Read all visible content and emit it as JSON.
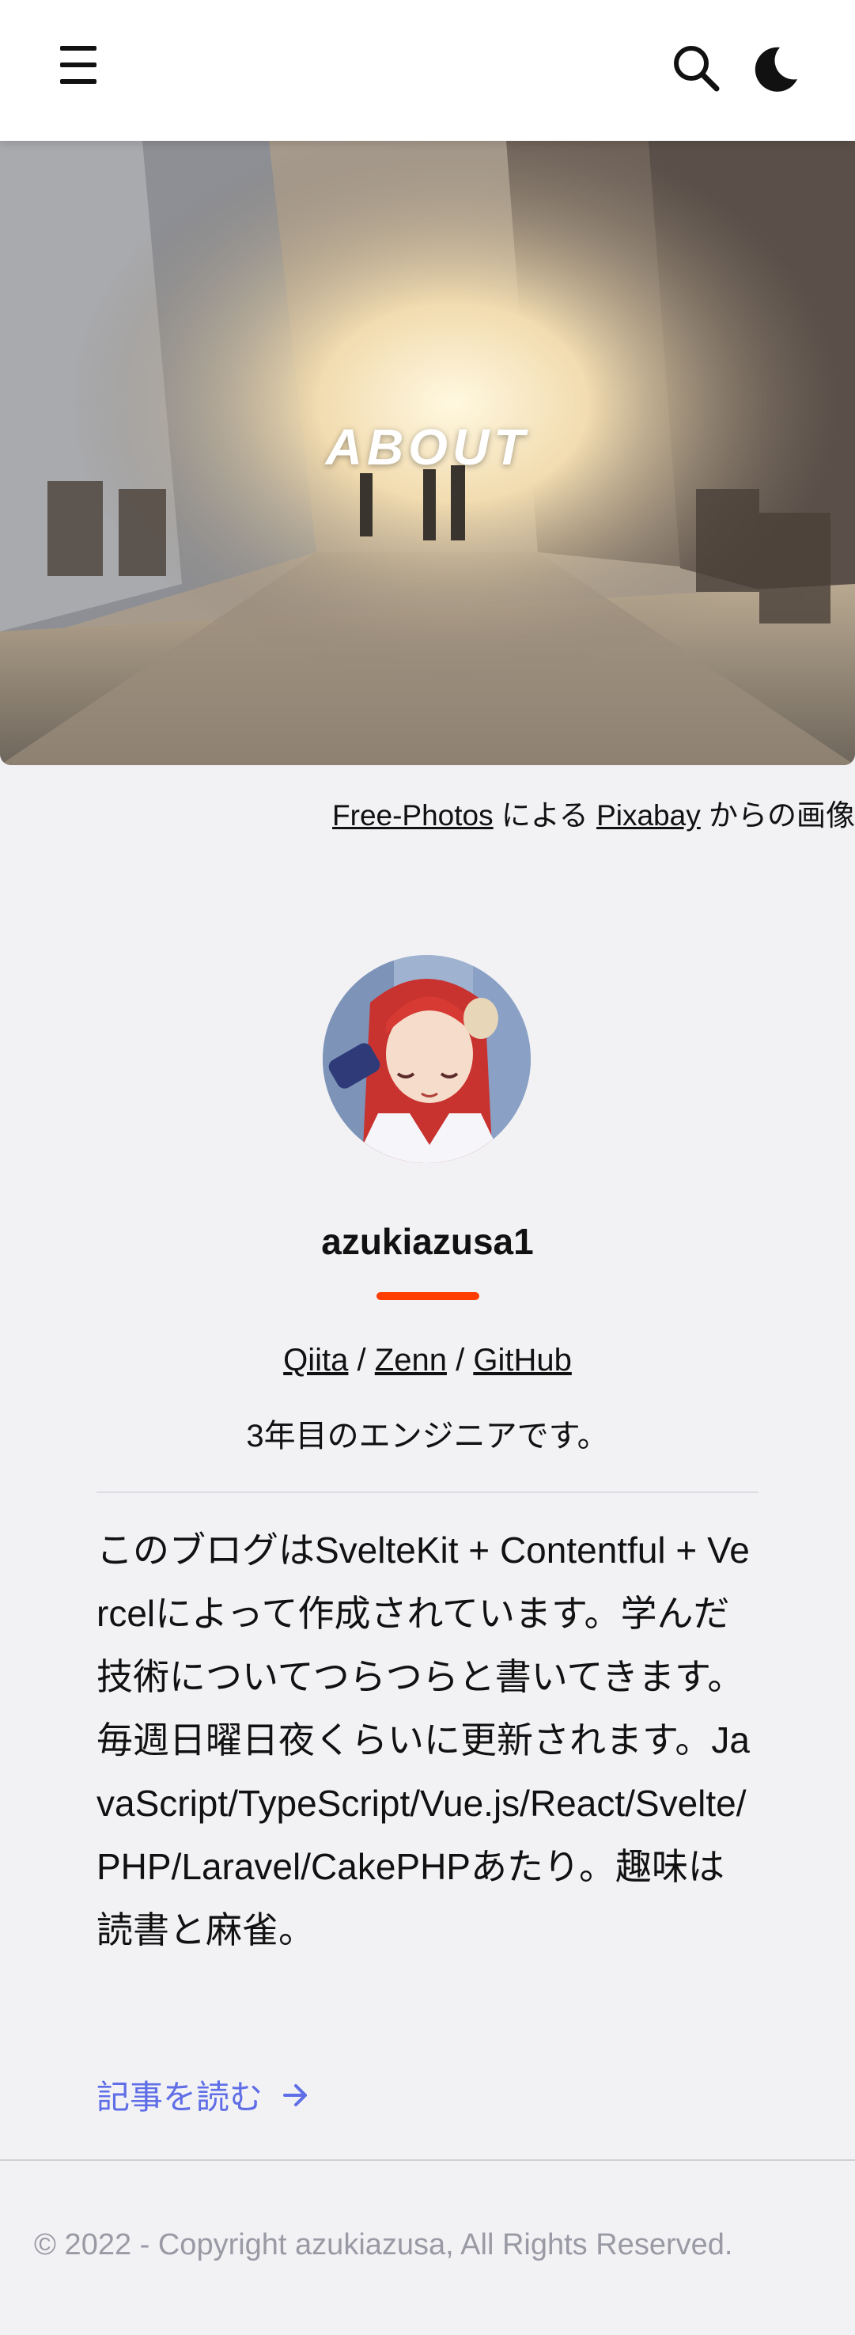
{
  "header": {
    "menu_icon": "hamburger-menu-icon",
    "search_icon": "search-icon",
    "theme_icon": "moon-icon"
  },
  "hero": {
    "title": "ABOUT"
  },
  "credit": {
    "author_link": "Free-Photos",
    "by_text": "による",
    "site_link": "Pixabay",
    "from_text": "からの画像"
  },
  "profile": {
    "username": "azukiazusa1",
    "links": {
      "qiita": "Qiita",
      "separator1": "/",
      "zenn": "Zenn",
      "separator2": "/",
      "github": "GitHub"
    },
    "tagline": "3年目のエンジニアです。",
    "bio": "このブログはSvelteKit + Contentful + Vercelによって作成されています。学んだ技術についてつらつらと書いてきます。毎週日曜日夜くらいに更新されます。JavaScript/TypeScript/Vue.js/React/Svelte/PHP/Laravel/CakePHPあたり。趣味は読書と麻雀。",
    "read_link": "記事を読む",
    "accent_color": "#ff3d00",
    "link_color": "#5f6ee6"
  },
  "footer": {
    "copyright": "© 2022 - Copyright azukiazusa, All Rights Reserved."
  }
}
